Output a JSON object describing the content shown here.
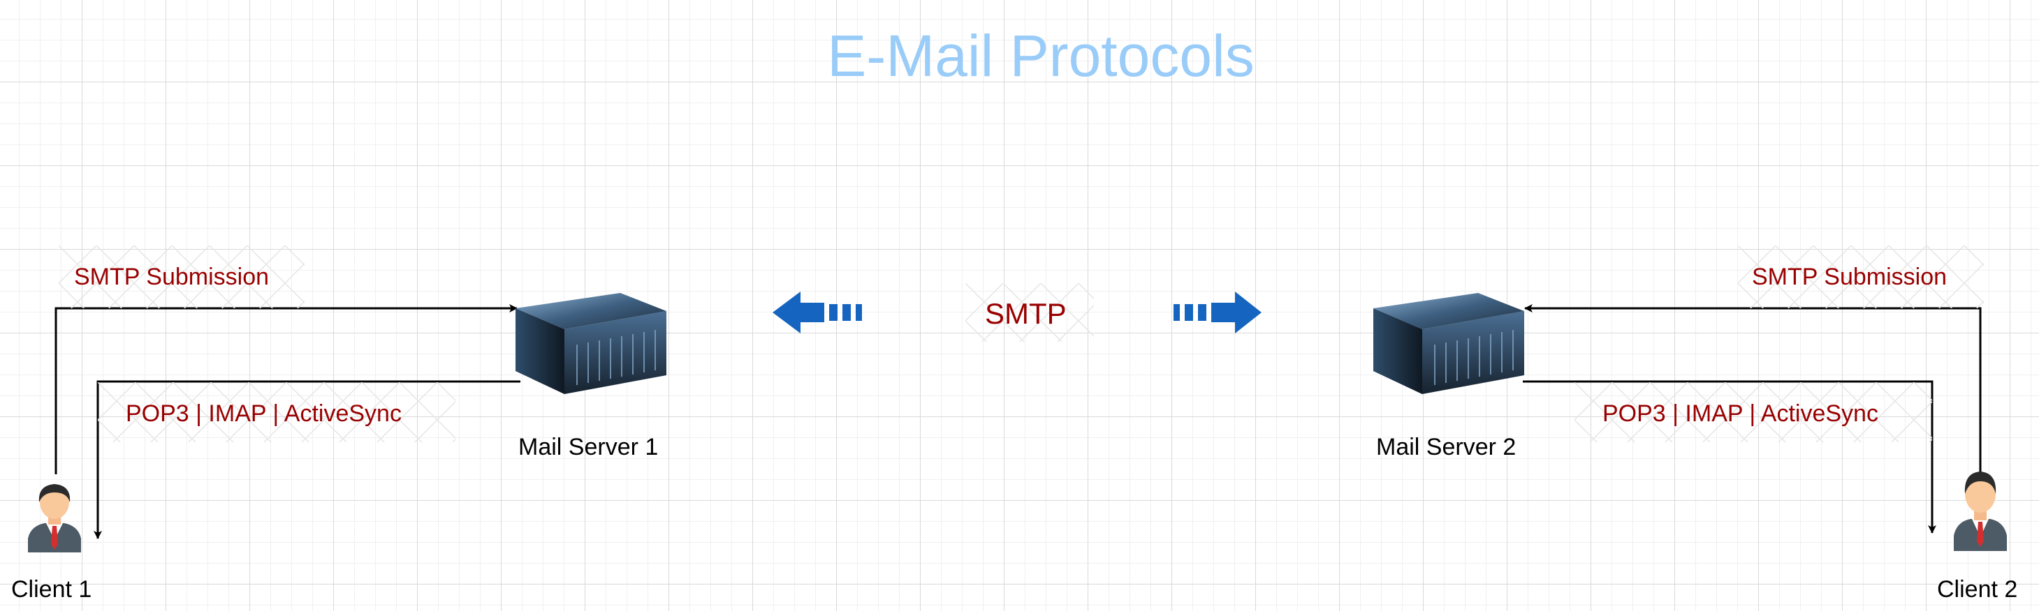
{
  "title": "E-Mail Protocols",
  "nodes": {
    "server1": "Mail Server 1",
    "server2": "Mail Server 2",
    "client1": "Client 1",
    "client2": "Client 2"
  },
  "edge_labels": {
    "smtp_submission_left": "SMTP Submission",
    "smtp_submission_right": "SMTP Submission",
    "retrieval_left": "POP3 |  IMAP  |  ActiveSync",
    "retrieval_right": "POP3 |  IMAP  |  ActiveSync",
    "smtp_center": "SMTP"
  },
  "colors": {
    "title": "#99ccf8",
    "label_red": "#990000",
    "arrow_blue": "#1565c0",
    "connector": "#000000"
  },
  "icons": {
    "server": "rack-server-icon",
    "client": "businessman-avatar-icon",
    "smtp_left_arrow": "dashed-left-arrow-icon",
    "smtp_right_arrow": "dashed-right-arrow-icon"
  }
}
